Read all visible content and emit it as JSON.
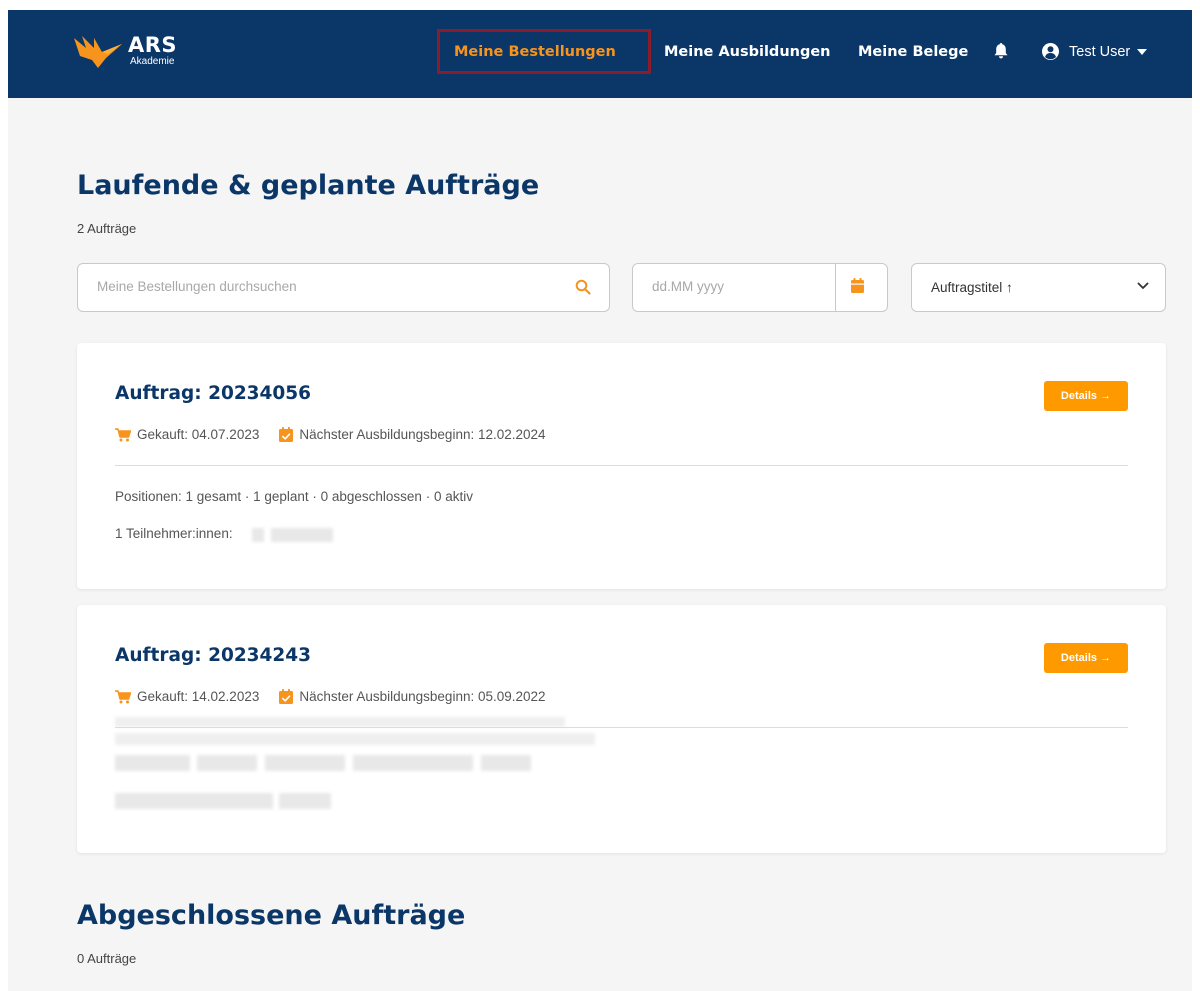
{
  "nav": {
    "logo_main": "ARS",
    "logo_sub": "Akademie",
    "items": [
      {
        "label": "Meine Bestellungen",
        "active": true
      },
      {
        "label": "Meine Ausbildungen",
        "active": false
      },
      {
        "label": "Meine Belege",
        "active": false
      }
    ],
    "user_name": "Test User",
    "icons": {
      "bell": "bell-icon",
      "user": "user-circle-icon",
      "caret": "caret-down-icon"
    }
  },
  "current": {
    "heading": "Laufende & geplante Aufträge",
    "count": "2 Aufträge"
  },
  "filters": {
    "search_placeholder": "Meine Bestellungen durchsuchen",
    "date_placeholder": "dd.MM yyyy",
    "sort_label": "Auftragstitel ↑"
  },
  "orders": [
    {
      "title": "Auftrag: 20234056",
      "details_label": "Details →",
      "purchased": "Gekauft: 04.07.2023",
      "next_start": "Nächster Ausbildungsbeginn: 12.02.2024",
      "positions": "Positionen: 1 gesamt · 1 geplant · 0 abgeschlossen · 0 aktiv",
      "participants": "1 Teilnehmer:innen:"
    },
    {
      "title": "Auftrag: 20234243",
      "details_label": "Details →",
      "purchased": "Gekauft: 14.02.2023",
      "next_start": "Nächster Ausbildungsbeginn: 05.09.2022"
    }
  ],
  "completed": {
    "heading": "Abgeschlossene Aufträge",
    "count": "0 Aufträge"
  },
  "colors": {
    "navbar": "#0b3668",
    "accent": "#f7941d",
    "button": "#ff9900",
    "active_outline": "#8b1c2c"
  }
}
